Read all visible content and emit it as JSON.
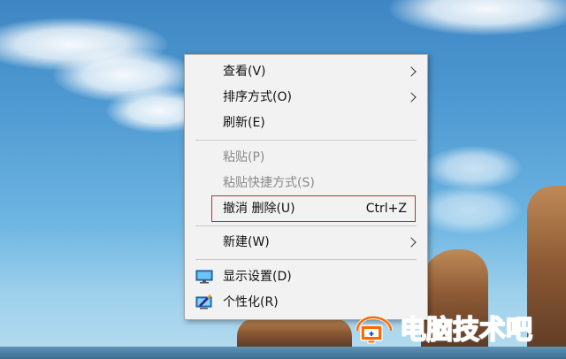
{
  "context_menu": {
    "items": [
      {
        "label": "查看(V)",
        "submenu": true,
        "enabled": true
      },
      {
        "label": "排序方式(O)",
        "submenu": true,
        "enabled": true
      },
      {
        "label": "刷新(E)",
        "enabled": true
      },
      {
        "label": "粘贴(P)",
        "enabled": false
      },
      {
        "label": "粘贴快捷方式(S)",
        "enabled": false
      },
      {
        "label": "撤消 删除(U)",
        "shortcut": "Ctrl+Z",
        "enabled": true,
        "highlighted": true
      },
      {
        "label": "新建(W)",
        "submenu": true,
        "enabled": true
      },
      {
        "label": "显示设置(D)",
        "icon": "display-settings-icon",
        "enabled": true
      },
      {
        "label": "个性化(R)",
        "icon": "personalize-icon",
        "enabled": true
      }
    ],
    "highlight_color": "#b8322e"
  },
  "watermark": {
    "text": "电脑技术吧",
    "logo": "computer-logo-icon",
    "color": "#ff6a00"
  }
}
